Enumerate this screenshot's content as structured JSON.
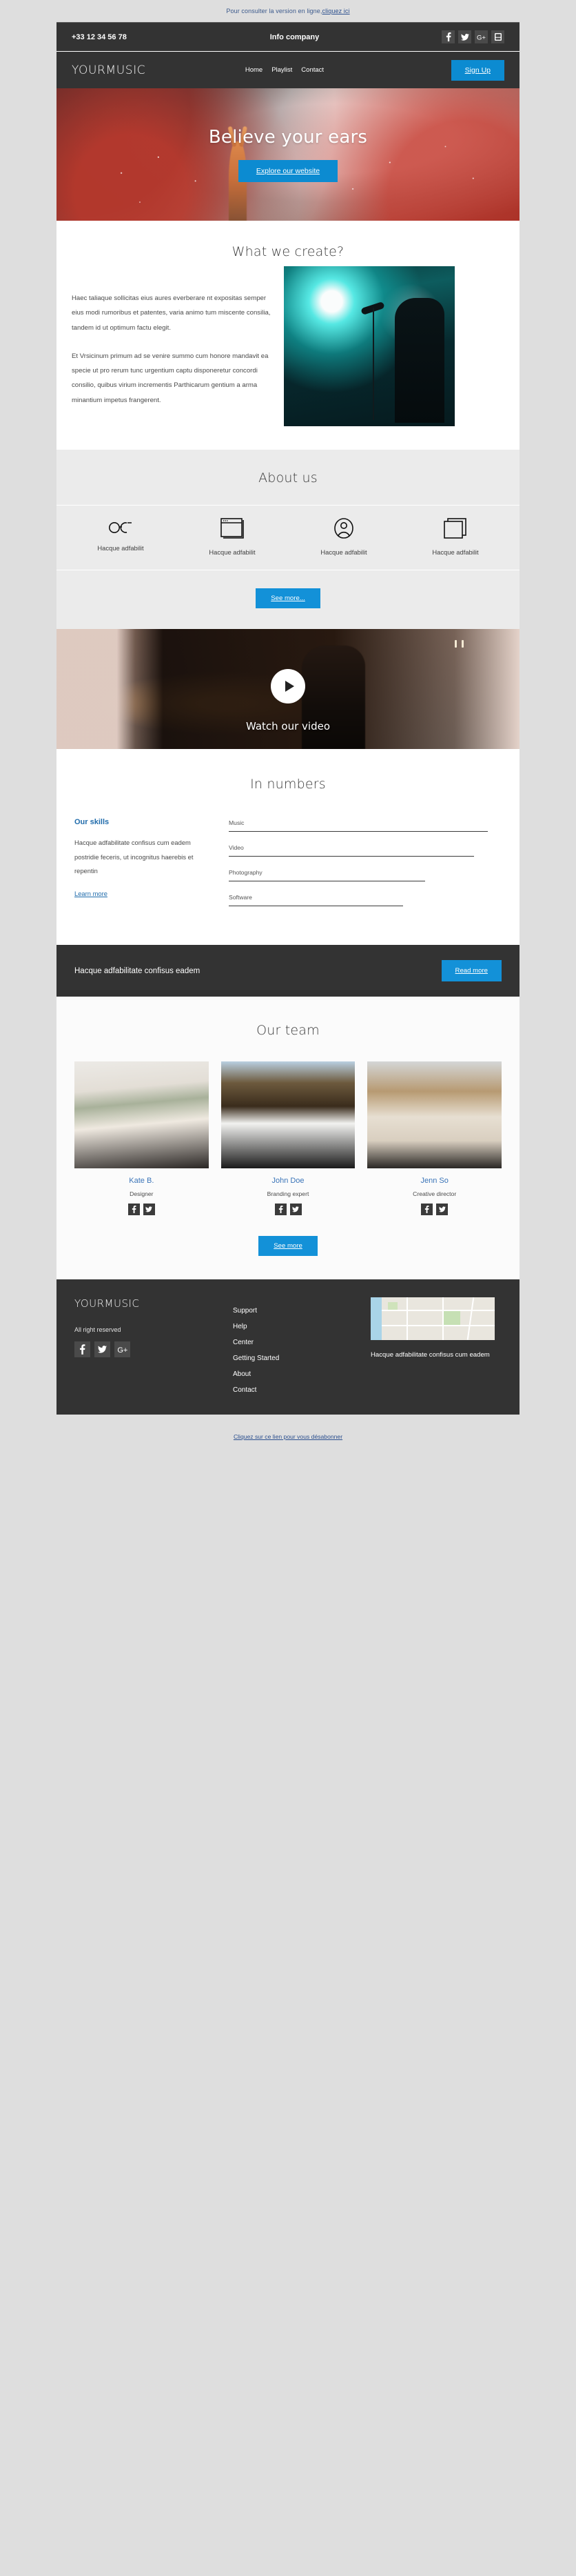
{
  "preheader": {
    "text": "Pour consulter la version en ligne, ",
    "link": "cliquez ici"
  },
  "topbar": {
    "phone": "+33 12 34 56 78",
    "info": "Info company",
    "socials": [
      "facebook-icon",
      "twitter-icon",
      "google-plus-icon",
      "youtube-icon"
    ]
  },
  "nav": {
    "logo": "YOURMUSIC",
    "links": [
      "Home",
      "Playlist",
      "Contact"
    ],
    "signup": "Sign Up"
  },
  "hero": {
    "title": "Believe your ears",
    "button": "Explore our website"
  },
  "create": {
    "title": "What we create?",
    "paragraph1": "Haec taliaque sollicitas eius aures everberare nt expositas semper eius modi rumoribus et patentes, varia animo tum miscente consilia, tandem id ut optimum factu elegit.",
    "paragraph2": "Et Vrsicinum primum ad se venire summo cum honore mandavit ea specie ut pro rerum tunc urgentium captu disponeretur concordi consilio, quibus virium incrementis Parthicarum gentium a arma minantium impetus frangerent."
  },
  "about": {
    "title": "About us",
    "features": [
      {
        "icon": "glasses-icon",
        "label": "Hacque adfabilit"
      },
      {
        "icon": "browser-window-icon",
        "label": "Hacque adfabilit"
      },
      {
        "icon": "user-avatar-icon",
        "label": "Hacque adfabilit"
      },
      {
        "icon": "copy-pages-icon",
        "label": "Hacque adfabilit"
      }
    ],
    "button": "See more..."
  },
  "video": {
    "caption": "Watch our video",
    "play": "play-icon"
  },
  "numbers": {
    "title": "In numbers",
    "skills_heading": "Our skills",
    "skills_text": "Hacque adfabilitate confisus cum eadem postridie feceris, ut incognitus haerebis et repentin",
    "learn_more": "Learn more",
    "bars": [
      {
        "label": "Music",
        "percent": 95
      },
      {
        "label": "Video",
        "percent": 90
      },
      {
        "label": "Photography",
        "percent": 72
      },
      {
        "label": "Software",
        "percent": 64
      }
    ]
  },
  "cta": {
    "text": "Hacque adfabilitate confisus eadem",
    "button": "Read more"
  },
  "team": {
    "title": "Our team",
    "members": [
      {
        "name": "Kate B.",
        "role": "Designer",
        "socials": [
          "facebook-icon",
          "twitter-icon"
        ]
      },
      {
        "name": "John Doe",
        "role": "Branding expert",
        "socials": [
          "facebook-icon",
          "twitter-icon"
        ]
      },
      {
        "name": "Jenn So",
        "role": "Creative director",
        "socials": [
          "facebook-icon",
          "twitter-icon"
        ]
      }
    ],
    "button": "See more"
  },
  "footer": {
    "logo": "YOURMUSIC",
    "rights": "All right reserved",
    "socials": [
      "facebook-icon",
      "twitter-icon",
      "google-plus-icon"
    ],
    "links": [
      "Support",
      "Help",
      "Center",
      "Getting Started",
      "About",
      "Contact"
    ],
    "map_caption": "Hacque adfabilitate confisus cum eadem"
  },
  "unsubscribe": "Cliquez sur ce lien pour vous désabonner",
  "colors": {
    "accent": "#0c8bd1",
    "dark": "#333333",
    "page_bg": "#dedede",
    "light_section": "#ebebeb",
    "link": "#2b4f8e"
  }
}
